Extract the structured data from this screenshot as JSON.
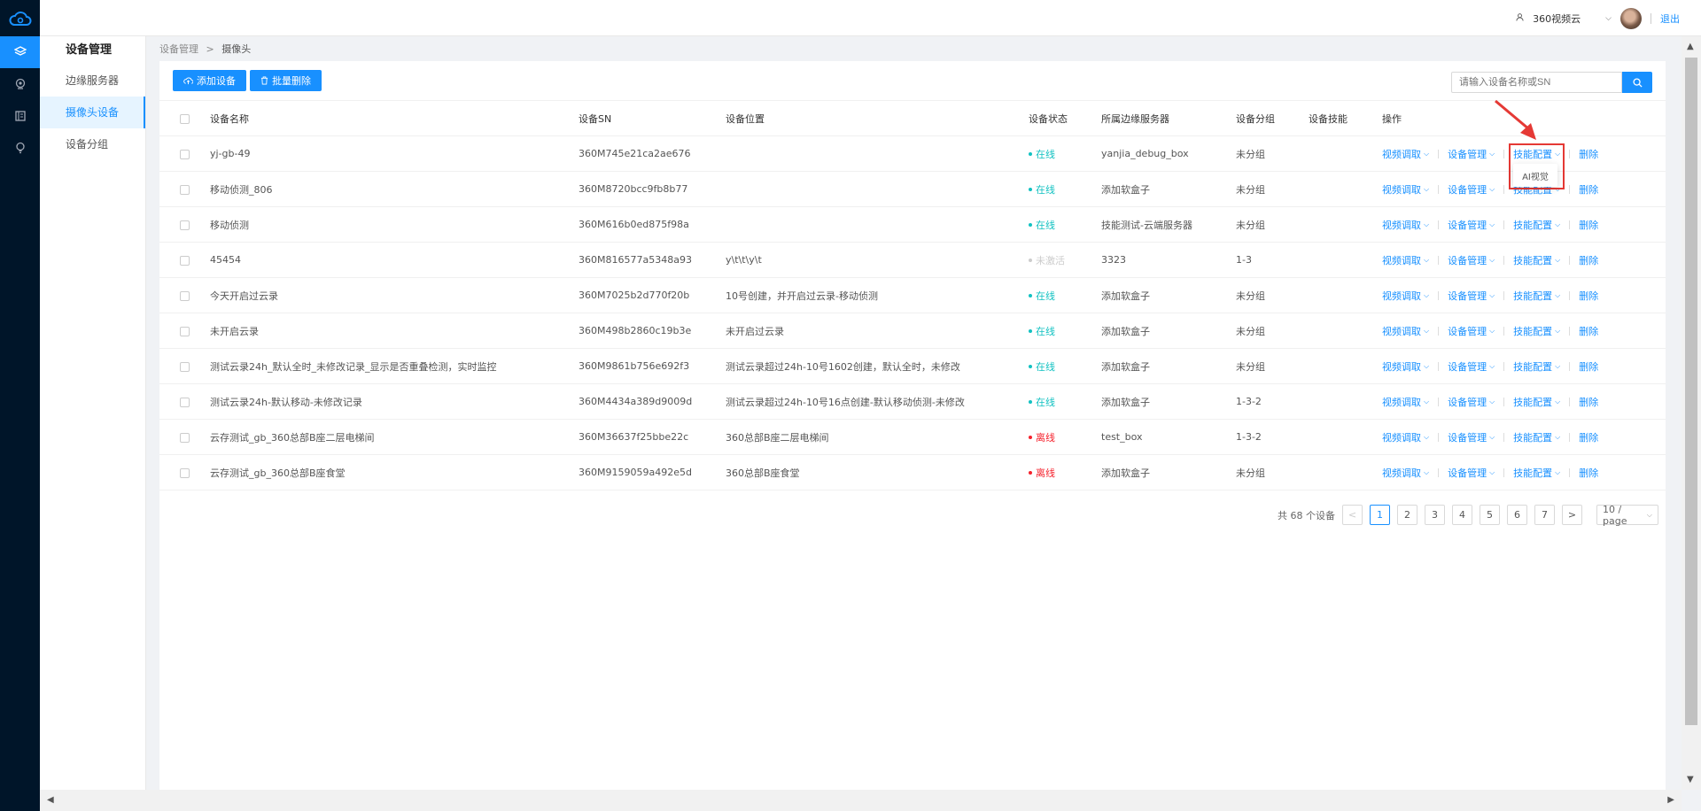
{
  "app": {
    "accent": "#1890ff",
    "rail_bg": "#001529"
  },
  "topbar": {
    "user": "360视频云",
    "logout": "退出"
  },
  "sidebar": {
    "title": "设备管理",
    "items": [
      {
        "label": "边缘服务器",
        "active": false
      },
      {
        "label": "摄像头设备",
        "active": true
      },
      {
        "label": "设备分组",
        "active": false
      }
    ]
  },
  "breadcrumb": {
    "parent": "设备管理",
    "sep": ">",
    "current": "摄像头"
  },
  "toolbar": {
    "add_label": "添加设备",
    "batch_delete_label": "批量删除"
  },
  "search": {
    "placeholder": "请输入设备名称或SN"
  },
  "table": {
    "headers": [
      "设备名称",
      "设备SN",
      "设备位置",
      "设备状态",
      "所属边缘服务器",
      "设备分组",
      "设备技能",
      "操作"
    ],
    "ops": {
      "video": "视频调取",
      "manage": "设备管理",
      "skill": "技能配置",
      "delete": "删除"
    },
    "rows": [
      {
        "name": "yj-gb-49",
        "sn": "360M745e21ca2ae676",
        "location": "",
        "status": "在线",
        "status_color": "#13c2c2",
        "server": "yanjia_debug_box",
        "group": "未分组"
      },
      {
        "name": "移动侦测_806",
        "sn": "360M8720bcc9fb8b77",
        "location": "",
        "status": "在线",
        "status_color": "#13c2c2",
        "server": "添加软盒子",
        "group": "未分组"
      },
      {
        "name": "移动侦测",
        "sn": "360M616b0ed875f98a",
        "location": "",
        "status": "在线",
        "status_color": "#13c2c2",
        "server": "技能测试-云端服务器",
        "group": "未分组"
      },
      {
        "name": "45454",
        "sn": "360M816577a5348a93",
        "location": "y\\t\\t\\y\\t",
        "status": "未激活",
        "status_color": "#cccccc",
        "server": "3323",
        "group": "1-3"
      },
      {
        "name": "今天开启过云录",
        "sn": "360M7025b2d770f20b",
        "location": "10号创建，并开启过云录-移动侦测",
        "status": "在线",
        "status_color": "#13c2c2",
        "server": "添加软盒子",
        "group": "未分组"
      },
      {
        "name": "未开启云录",
        "sn": "360M498b2860c19b3e",
        "location": "未开启过云录",
        "status": "在线",
        "status_color": "#13c2c2",
        "server": "添加软盒子",
        "group": "未分组"
      },
      {
        "name": "测试云录24h_默认全时_未修改记录_显示是否重叠检测，实时监控",
        "sn": "360M9861b756e692f3",
        "location": "测试云录超过24h-10号1602创建，默认全时，未修改",
        "status": "在线",
        "status_color": "#13c2c2",
        "server": "添加软盒子",
        "group": "未分组"
      },
      {
        "name": "测试云录24h-默认移动-未修改记录",
        "sn": "360M4434a389d9009d",
        "location": "测试云录超过24h-10号16点创建-默认移动侦测-未修改",
        "status": "在线",
        "status_color": "#13c2c2",
        "server": "添加软盒子",
        "group": "1-3-2"
      },
      {
        "name": "云存测试_gb_360总部B座二层电梯间",
        "sn": "360M36637f25bbe22c",
        "location": "360总部B座二层电梯间",
        "status": "离线",
        "status_color": "#f5222d",
        "server": "test_box",
        "group": "1-3-2"
      },
      {
        "name": "云存测试_gb_360总部B座食堂",
        "sn": "360M9159059a492e5d",
        "location": "360总部B座食堂",
        "status": "离线",
        "status_color": "#f5222d",
        "server": "添加软盒子",
        "group": "未分组"
      }
    ]
  },
  "dropdown": {
    "item": "AI视觉"
  },
  "pagination": {
    "total_label": "共 68 个设备",
    "pages": [
      "1",
      "2",
      "3",
      "4",
      "5",
      "6",
      "7"
    ],
    "current": "1",
    "page_size": "10 / page"
  }
}
